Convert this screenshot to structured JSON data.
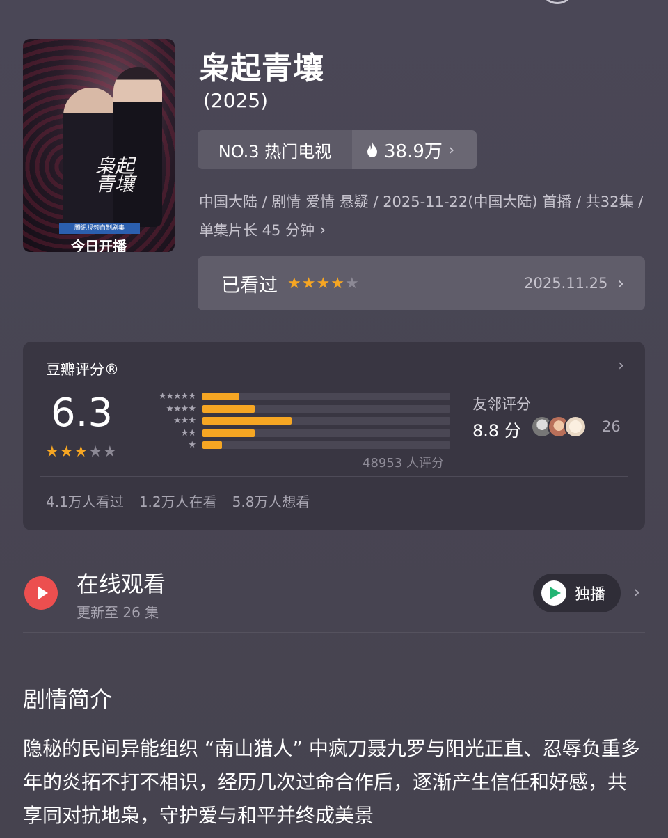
{
  "movie": {
    "title": "枭起青壤",
    "year": "(2025)",
    "rank": "NO.3 热门电视",
    "heat": "38.9万",
    "meta": "中国大陆 / 剧情 爱情 悬疑 / 2025-11-22(中国大陆) 首播 / 共32集 / 单集片长 45 分钟",
    "meta_chevron": "›"
  },
  "poster": {
    "calligraphy": "枭起青壤",
    "banner": "腾讯视频自制剧集",
    "caption": "今日开播"
  },
  "watched": {
    "label": "已看过",
    "rating": 4,
    "date": "2025.11.25"
  },
  "douban": {
    "title": "豆瓣评分®",
    "score": "6.3",
    "score_stars": 3,
    "distribution": [
      {
        "label": "★★★★★",
        "value": 0.15
      },
      {
        "label": "★★★★",
        "value": 0.21
      },
      {
        "label": "★★★",
        "value": 0.36
      },
      {
        "label": "★★",
        "value": 0.21
      },
      {
        "label": "★",
        "value": 0.08
      }
    ],
    "votes": "48953 人评分",
    "friend_label": "友邻评分",
    "friend_score": "8.8 分",
    "friend_count": "26",
    "stats": [
      "4.1万人看过",
      "1.2万人在看",
      "5.8万人想看"
    ]
  },
  "online": {
    "title": "在线观看",
    "subtitle": "更新至 26 集",
    "badge": "独播"
  },
  "synopsis": {
    "title": "剧情简介",
    "text": "隐秘的民间异能组织 “南山猎人” 中疯刀聂九罗与阳光正直、忍辱负重多年的炎拓不打不相识，经历几次过命合作后，逐渐产生信任和好感，共享同对抗地枭，守护爱与和平并终成美景"
  },
  "colors": {
    "accent_star": "#f6a623",
    "play_red": "#ec4f4f",
    "tencent_green": "#22b573"
  }
}
